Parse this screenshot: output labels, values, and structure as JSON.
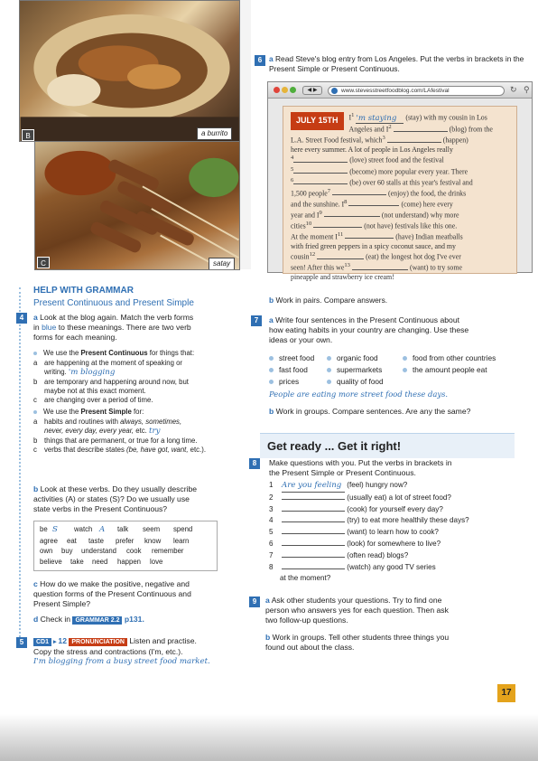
{
  "photos": {
    "b": {
      "caption": "a burrito",
      "letter": "B"
    },
    "c": {
      "caption": "satay",
      "letter": "C"
    }
  },
  "ex6": {
    "num": "6",
    "letter_a": "a",
    "instruction": "Read Steve's blog entry from Los Angeles. Put the verbs in brackets in the Present Simple or Present Continuous.",
    "url": "www.stevesstreetfoodblog.com/LAfestival",
    "blog": {
      "date": "JULY 15TH",
      "l1a": "I",
      "s1": "1",
      "ans1": "'m staying",
      "l1b": "(stay) with my cousin in Los",
      "l2a": "Angeles and I",
      "s2": "2",
      "l2b": "(blog) from the",
      "l3a": "L.A. Street Food festival, which",
      "s3": "3",
      "l3b": "(happen)",
      "l4": "here every summer. A lot of people in Los Angeles really",
      "n4": "4",
      "l5": "(love) street food and the festival",
      "n5": "5",
      "l6": "(become) more popular every year. There",
      "n6": "6",
      "l7": "(be) over 60 stalls at this year's festival and",
      "l8a": "1,500 people",
      "s7": "7",
      "l8b": "(enjoy) the food, the drinks",
      "l9a": "and the sunshine. I",
      "s8": "8",
      "l9b": "(come) here every",
      "l10a": "year and I",
      "s9": "9",
      "l10b": "(not understand) why more",
      "l11a": "cities",
      "s10": "10",
      "l11b": "(not have) festivals like this one.",
      "l12a": "At the moment I",
      "s11": "11",
      "l12b": "(have) Indian meatballs",
      "l13": "with fried green peppers in a spicy coconut sauce, and my",
      "l14a": "cousin",
      "s12": "12",
      "l14b": "(eat) the longest hot dog I've ever",
      "l15a": "seen! After this we",
      "s13": "13",
      "l15b": "(want) to try some",
      "l16": "pineapple and strawberry ice cream!"
    },
    "b_letter": "b",
    "b_text": "Work in pairs. Compare answers."
  },
  "help": {
    "title": "HELP WITH GRAMMAR",
    "subtitle": "Present Continuous and Present Simple",
    "ex4_num": "4",
    "a_letter": "a",
    "a_text1": "Look at the blog again. Match the verb forms",
    "a_text2_in": "in",
    "a_text2_blue": "blue",
    "a_text2_rest": "to these meanings. There are two verb",
    "a_text3": "forms for each meaning.",
    "pc_intro_a": "We use the",
    "pc_intro_b": "Present Continuous",
    "pc_intro_c": "for things that:",
    "pc_a_letter": "a",
    "pc_a_1": "are happening at the moment of speaking or",
    "pc_a_2": "writing.",
    "pc_a_ans": "'m blogging",
    "pc_b_letter": "b",
    "pc_b_1": "are temporary and happening around now, but",
    "pc_b_2": "maybe not at this exact moment.",
    "pc_c_letter": "c",
    "pc_c_1": "are changing over a period of time.",
    "ps_intro_a": "We use the",
    "ps_intro_b": "Present Simple",
    "ps_intro_c": "for:",
    "ps_a_letter": "a",
    "ps_a_1": "habits and routines with",
    "ps_a_1i": "always, sometimes,",
    "ps_a_2i": "never, every day, every year,",
    "ps_a_2": "etc.",
    "ps_a_ans": "try",
    "ps_b_letter": "b",
    "ps_b_1": "things that are permanent, or true for a long time.",
    "ps_c_letter": "c",
    "ps_c_1": "verbs that describe states",
    "ps_c_1i": "(be, have got, want,",
    "ps_c_1e": "etc.).",
    "b_letter": "b",
    "b_text1": "Look at these verbs. Do they usually describe",
    "b_text2": "activities (A) or states (S)? Do we usually use",
    "b_text3": "state verbs in the Present Continuous?",
    "wordbox": [
      [
        "be",
        "S",
        "watch",
        "A",
        "talk",
        "seem",
        "spend"
      ],
      [
        "agree",
        "eat",
        "taste",
        "prefer",
        "know",
        "learn"
      ],
      [
        "own",
        "buy",
        "understand",
        "cook",
        "remember"
      ],
      [
        "believe",
        "take",
        "need",
        "happen",
        "love"
      ]
    ],
    "c_letter": "c",
    "c_text1": "How do we make the positive, negative and",
    "c_text2": "question forms of the Present Continuous and",
    "c_text3": "Present Simple?",
    "d_letter": "d",
    "d_text": "Check in",
    "d_badge": "GRAMMAR 2.2",
    "d_page": "p131."
  },
  "ex5": {
    "num": "5",
    "cd": "CD1",
    "track": "12",
    "badge": "PRONUNCIATION",
    "text1": "Listen and practise.",
    "text2": "Copy the stress and contractions (I'm, etc.).",
    "example": "I'm blogging from a busy street food market."
  },
  "ex7": {
    "num": "7",
    "a_letter": "a",
    "a_text1": "Write four sentences in the Present Continuous about",
    "a_text2": "how eating habits in your country are changing. Use these",
    "a_text3": "ideas or your own.",
    "ideas_col1": [
      "street food",
      "fast food",
      "prices"
    ],
    "ideas_col2": [
      "organic food",
      "supermarkets",
      "quality of food"
    ],
    "ideas_col3": [
      "food from other countries",
      "the amount people eat"
    ],
    "example": "People are eating more street food these days.",
    "b_letter": "b",
    "b_text": "Work in groups. Compare sentences. Are any the same?"
  },
  "getready": {
    "title": "Get ready ... Get it right!"
  },
  "ex8": {
    "num": "8",
    "text1": "Make questions with you. Put the verbs in brackets in",
    "text2": "the Present Simple or Present Continuous.",
    "items": [
      {
        "n": "1",
        "ans": "Are you feeling",
        "rest": "(feel) hungry now?"
      },
      {
        "n": "2",
        "ans": "",
        "rest": "(usually eat) a lot of street food?"
      },
      {
        "n": "3",
        "ans": "",
        "rest": "(cook) for yourself every day?"
      },
      {
        "n": "4",
        "ans": "",
        "rest": "(try) to eat more healthily these days?"
      },
      {
        "n": "5",
        "ans": "",
        "rest": "(want) to learn how to cook?"
      },
      {
        "n": "6",
        "ans": "",
        "rest": "(look) for somewhere to live?"
      },
      {
        "n": "7",
        "ans": "",
        "rest": "(often read) blogs?"
      },
      {
        "n": "8",
        "ans": "",
        "rest": "(watch) any good TV series"
      }
    ],
    "item8_cont": "at the moment?"
  },
  "ex9": {
    "num": "9",
    "a_letter": "a",
    "a_text1": "Ask other students your questions. Try to find one",
    "a_text2": "person who answers yes for each question. Then ask",
    "a_text3": "two follow-up questions.",
    "b_letter": "b",
    "b_text1": "Work in groups. Tell other students three things you",
    "b_text2": "found out about the class."
  },
  "page_number": "17"
}
